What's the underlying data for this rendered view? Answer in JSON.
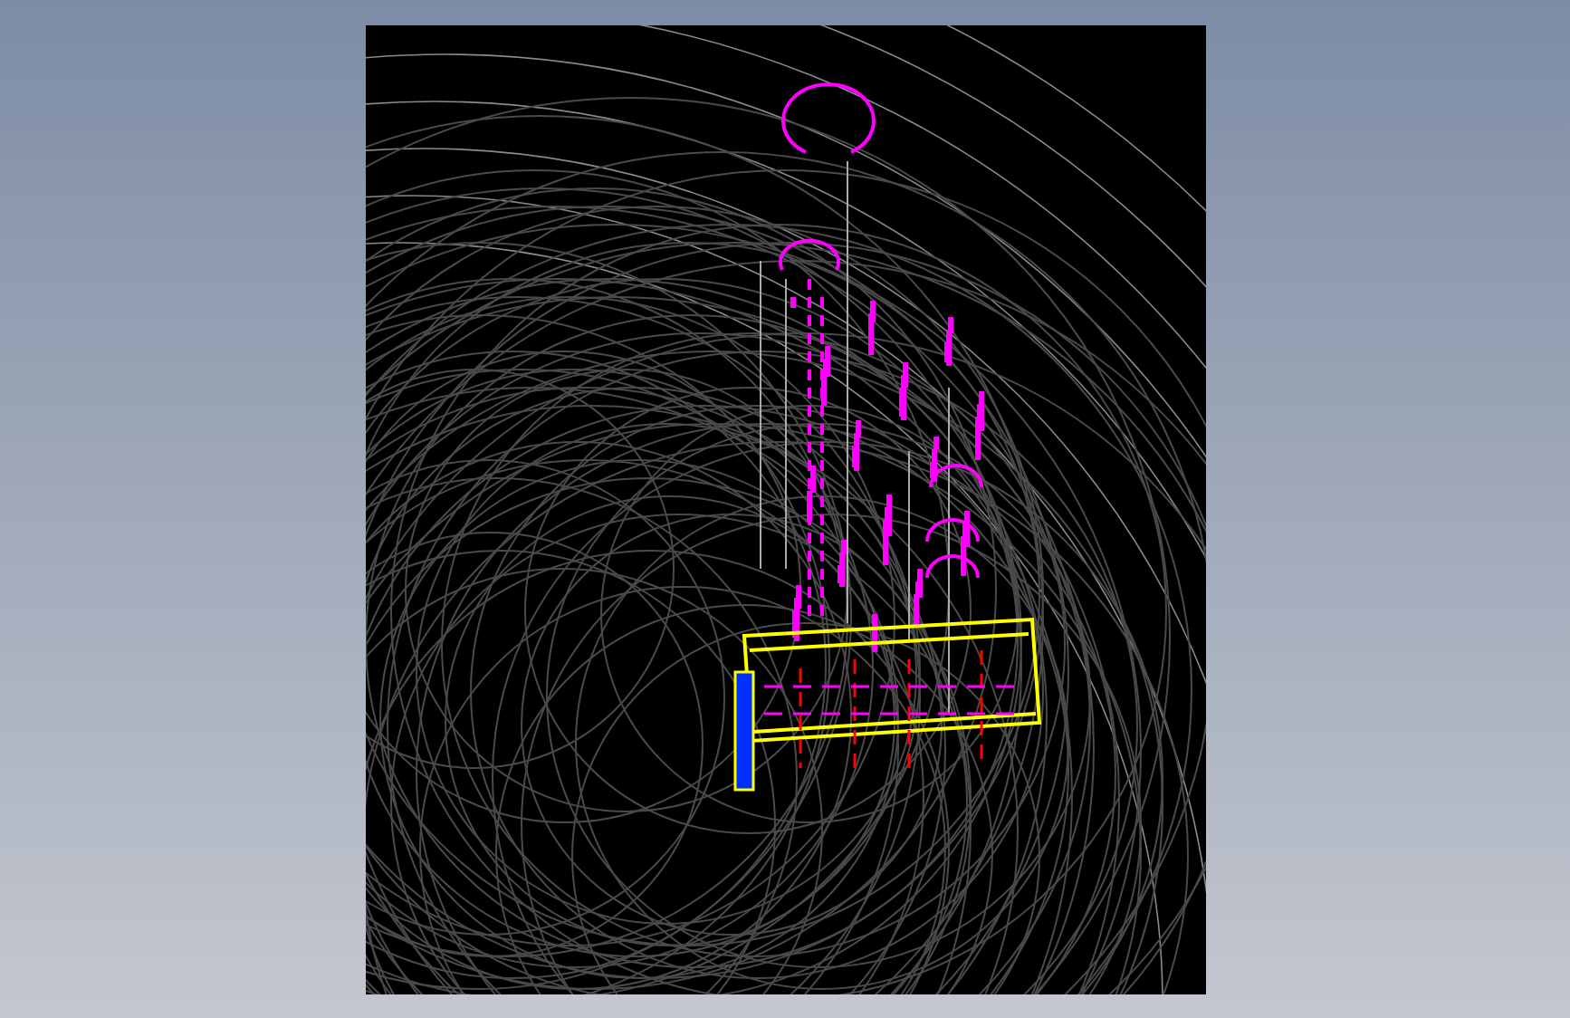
{
  "viewport": {
    "kind": "cad-wireframe"
  }
}
